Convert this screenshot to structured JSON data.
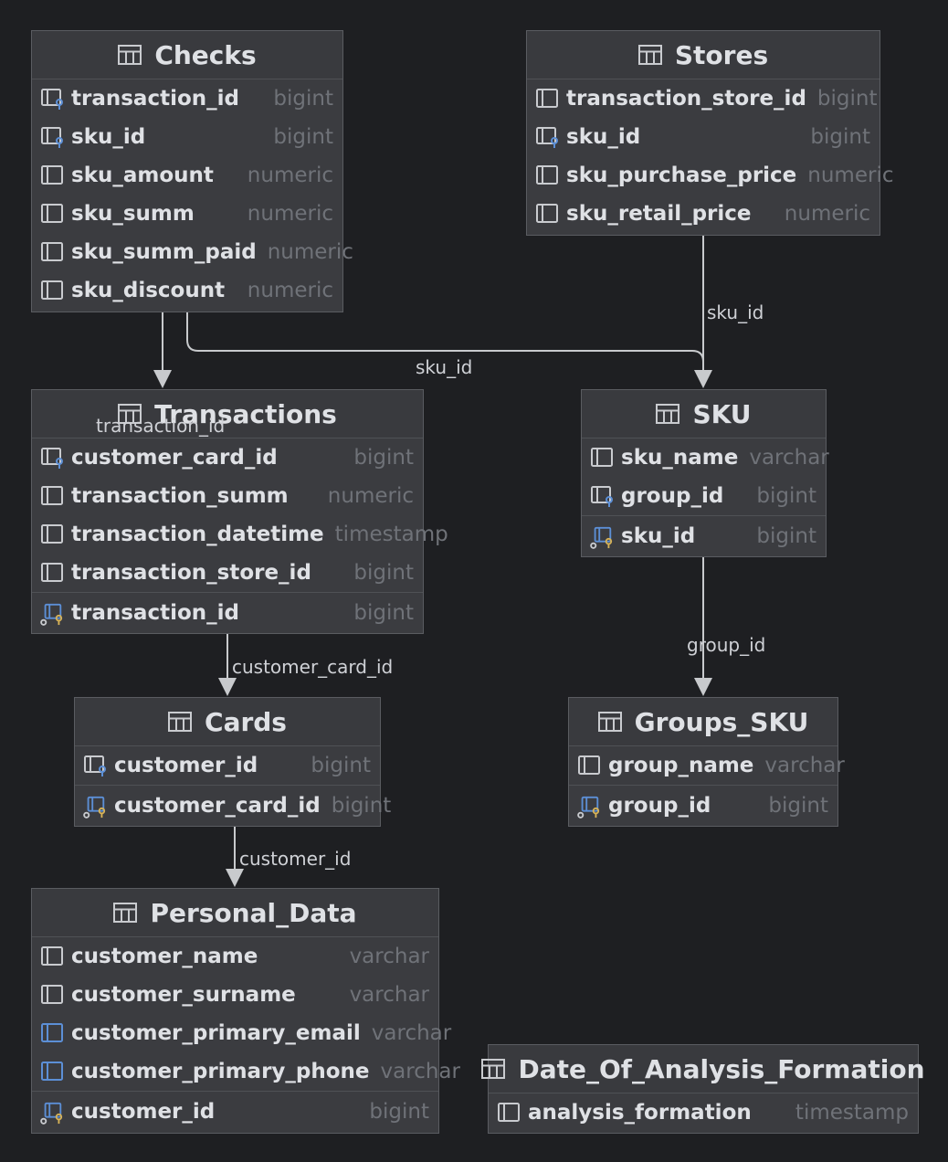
{
  "tables": {
    "checks": {
      "name": "Checks",
      "columns": [
        {
          "name": "transaction_id",
          "type": "bigint"
        },
        {
          "name": "sku_id",
          "type": "bigint"
        },
        {
          "name": "sku_amount",
          "type": "numeric"
        },
        {
          "name": "sku_summ",
          "type": "numeric"
        },
        {
          "name": "sku_summ_paid",
          "type": "numeric"
        },
        {
          "name": "sku_discount",
          "type": "numeric"
        }
      ]
    },
    "stores": {
      "name": "Stores",
      "columns": [
        {
          "name": "transaction_store_id",
          "type": "bigint"
        },
        {
          "name": "sku_id",
          "type": "bigint"
        },
        {
          "name": "sku_purchase_price",
          "type": "numeric"
        },
        {
          "name": "sku_retail_price",
          "type": "numeric"
        }
      ]
    },
    "transactions": {
      "name": "Transactions",
      "columns": [
        {
          "name": "customer_card_id",
          "type": "bigint"
        },
        {
          "name": "transaction_summ",
          "type": "numeric"
        },
        {
          "name": "transaction_datetime",
          "type": "timestamp"
        },
        {
          "name": "transaction_store_id",
          "type": "bigint"
        },
        {
          "name": "transaction_id",
          "type": "bigint"
        }
      ]
    },
    "sku": {
      "name": "SKU",
      "columns": [
        {
          "name": "sku_name",
          "type": "varchar"
        },
        {
          "name": "group_id",
          "type": "bigint"
        },
        {
          "name": "sku_id",
          "type": "bigint"
        }
      ]
    },
    "cards": {
      "name": "Cards",
      "columns": [
        {
          "name": "customer_id",
          "type": "bigint"
        },
        {
          "name": "customer_card_id",
          "type": "bigint"
        }
      ]
    },
    "groups_sku": {
      "name": "Groups_SKU",
      "columns": [
        {
          "name": "group_name",
          "type": "varchar"
        },
        {
          "name": "group_id",
          "type": "bigint"
        }
      ]
    },
    "personal_data": {
      "name": "Personal_Data",
      "columns": [
        {
          "name": "customer_name",
          "type": "varchar"
        },
        {
          "name": "customer_surname",
          "type": "varchar"
        },
        {
          "name": "customer_primary_email",
          "type": "varchar"
        },
        {
          "name": "customer_primary_phone",
          "type": "varchar"
        },
        {
          "name": "customer_id",
          "type": "bigint"
        }
      ]
    },
    "date_analysis": {
      "name": "Date_Of_Analysis_Formation",
      "columns": [
        {
          "name": "analysis_formation",
          "type": "timestamp"
        }
      ]
    }
  },
  "relations": {
    "checks_to_transactions": "transaction_id",
    "checks_to_sku": "sku_id",
    "stores_to_sku": "sku_id",
    "transactions_to_cards": "customer_card_id",
    "sku_to_groups": "group_id",
    "cards_to_personal": "customer_id"
  },
  "icons": {
    "table": "table-icon",
    "column": "column-icon",
    "foreign_key": "foreign-key-column-icon",
    "primary_key": "primary-key-column-icon",
    "indexed": "indexed-column-icon"
  },
  "colors": {
    "background": "#1e1f22",
    "table_fill": "#3b3c40",
    "text": "#dfe1e5",
    "type_text": "#6f7278",
    "fk_blue": "#5c8fd6",
    "pk_gold": "#d8b357",
    "edge": "#c8cacd"
  }
}
